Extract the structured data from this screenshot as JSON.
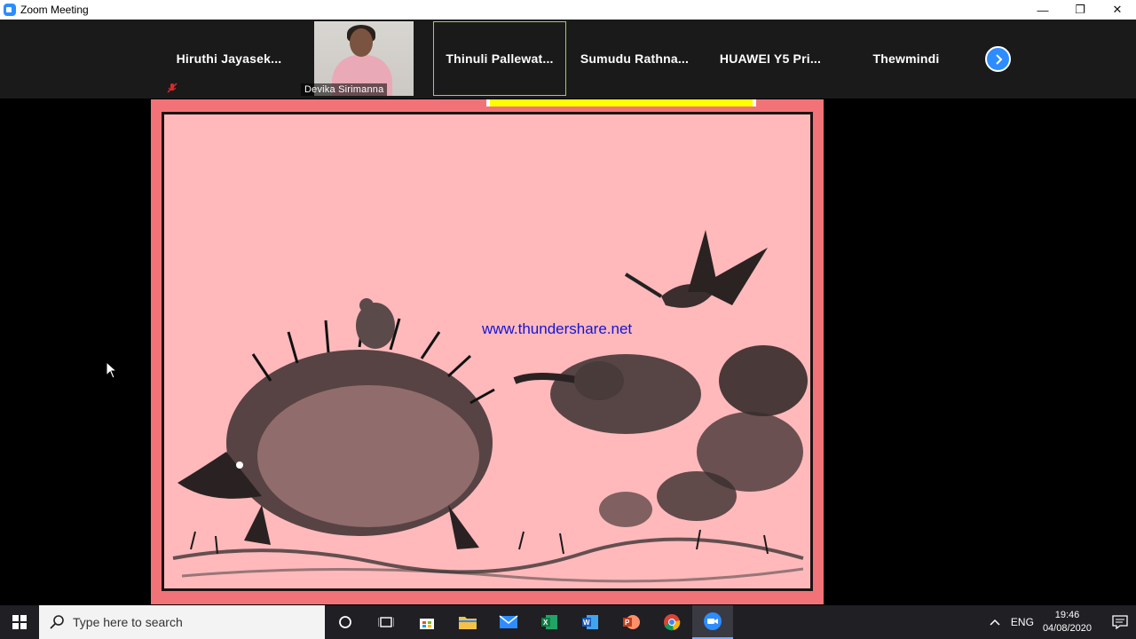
{
  "window": {
    "title": "Zoom Meeting"
  },
  "gallery": {
    "participants": [
      {
        "name": "Hiruthi  Jayasek...",
        "muted": true
      },
      {
        "name": "Devika Sirimanna",
        "video": true
      },
      {
        "name": "Thinuli  Pallewat...",
        "muted": true,
        "speaking": true
      },
      {
        "name": "Sumudu  Rathna..."
      },
      {
        "name": "HUAWEI Y5 Pri..."
      },
      {
        "name": "Thewmindi"
      }
    ]
  },
  "shared_screen": {
    "watermark": "www.thundershare.net"
  },
  "taskbar": {
    "search_placeholder": "Type here to search",
    "apps": [
      "cortana-icon",
      "task-view-icon",
      "store-icon",
      "file-explorer-icon",
      "mail-icon",
      "excel-icon",
      "word-icon",
      "powerpoint-icon",
      "chrome-icon",
      "zoom-icon"
    ],
    "tray": {
      "language": "ENG",
      "time": "19:46",
      "date": "04/08/2020"
    }
  },
  "colors": {
    "zoom_blue": "#2d8cff",
    "slide_pink": "#ffb9bb",
    "slide_border": "#f27377",
    "active_tile": "#9bd05a"
  }
}
